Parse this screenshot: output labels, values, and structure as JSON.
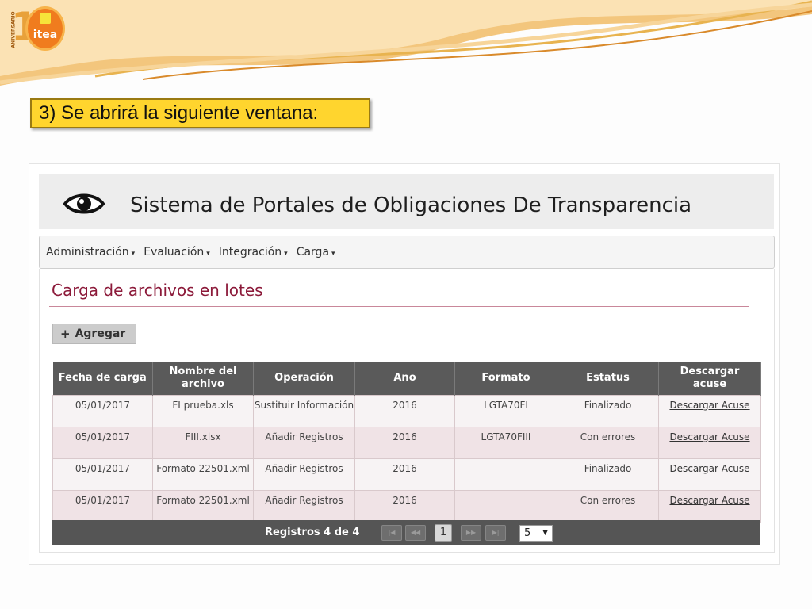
{
  "logo": {
    "number": "10",
    "brand": "itea",
    "tagline": "ANIVERSARIO"
  },
  "instruction": "3) Se abrirá la siguiente ventana:",
  "app": {
    "icon": "eye-icon",
    "title": "Sistema de Portales de Obligaciones De Transparencia"
  },
  "nav": {
    "items": [
      {
        "label": "Administración"
      },
      {
        "label": "Evaluación"
      },
      {
        "label": "Integración"
      },
      {
        "label": "Carga"
      }
    ],
    "caret": "▾"
  },
  "page": {
    "title": "Carga de archivos en lotes",
    "add_button": {
      "icon": "+",
      "label": "Agregar"
    }
  },
  "table": {
    "headers": [
      "Fecha de carga",
      "Nombre del archivo",
      "Operación",
      "Año",
      "Formato",
      "Estatus",
      "Descargar acuse"
    ],
    "rows": [
      {
        "fecha": "05/01/2017",
        "nombre": "FI prueba.xls",
        "operacion": "Sustituir Información",
        "anio": "2016",
        "formato": "LGTA70FI",
        "estatus": "Finalizado",
        "acuse": "Descargar Acuse"
      },
      {
        "fecha": "05/01/2017",
        "nombre": "FIII.xlsx",
        "operacion": "Añadir Registros",
        "anio": "2016",
        "formato": "LGTA70FIII",
        "estatus": "Con errores",
        "acuse": "Descargar Acuse"
      },
      {
        "fecha": "05/01/2017",
        "nombre": "Formato 22501.xml",
        "operacion": "Añadir Registros",
        "anio": "2016",
        "formato": "",
        "estatus": "Finalizado",
        "acuse": "Descargar Acuse"
      },
      {
        "fecha": "05/01/2017",
        "nombre": "Formato 22501.xml",
        "operacion": "Añadir Registros",
        "anio": "2016",
        "formato": "",
        "estatus": "Con errores",
        "acuse": "Descargar Acuse"
      }
    ]
  },
  "pager": {
    "label": "Registros 4 de 4",
    "first": "|◀",
    "prev": "◀◀",
    "current": "1",
    "next": "▶▶",
    "last": "▶|",
    "page_size": "5",
    "dropdown": "▼"
  },
  "colors": {
    "instruction_bg": "#ffd52e",
    "title_red": "#8c1a3a",
    "table_header": "#5a5a5a",
    "row_odd": "#f7f3f4",
    "row_even": "#f0e3e6"
  }
}
